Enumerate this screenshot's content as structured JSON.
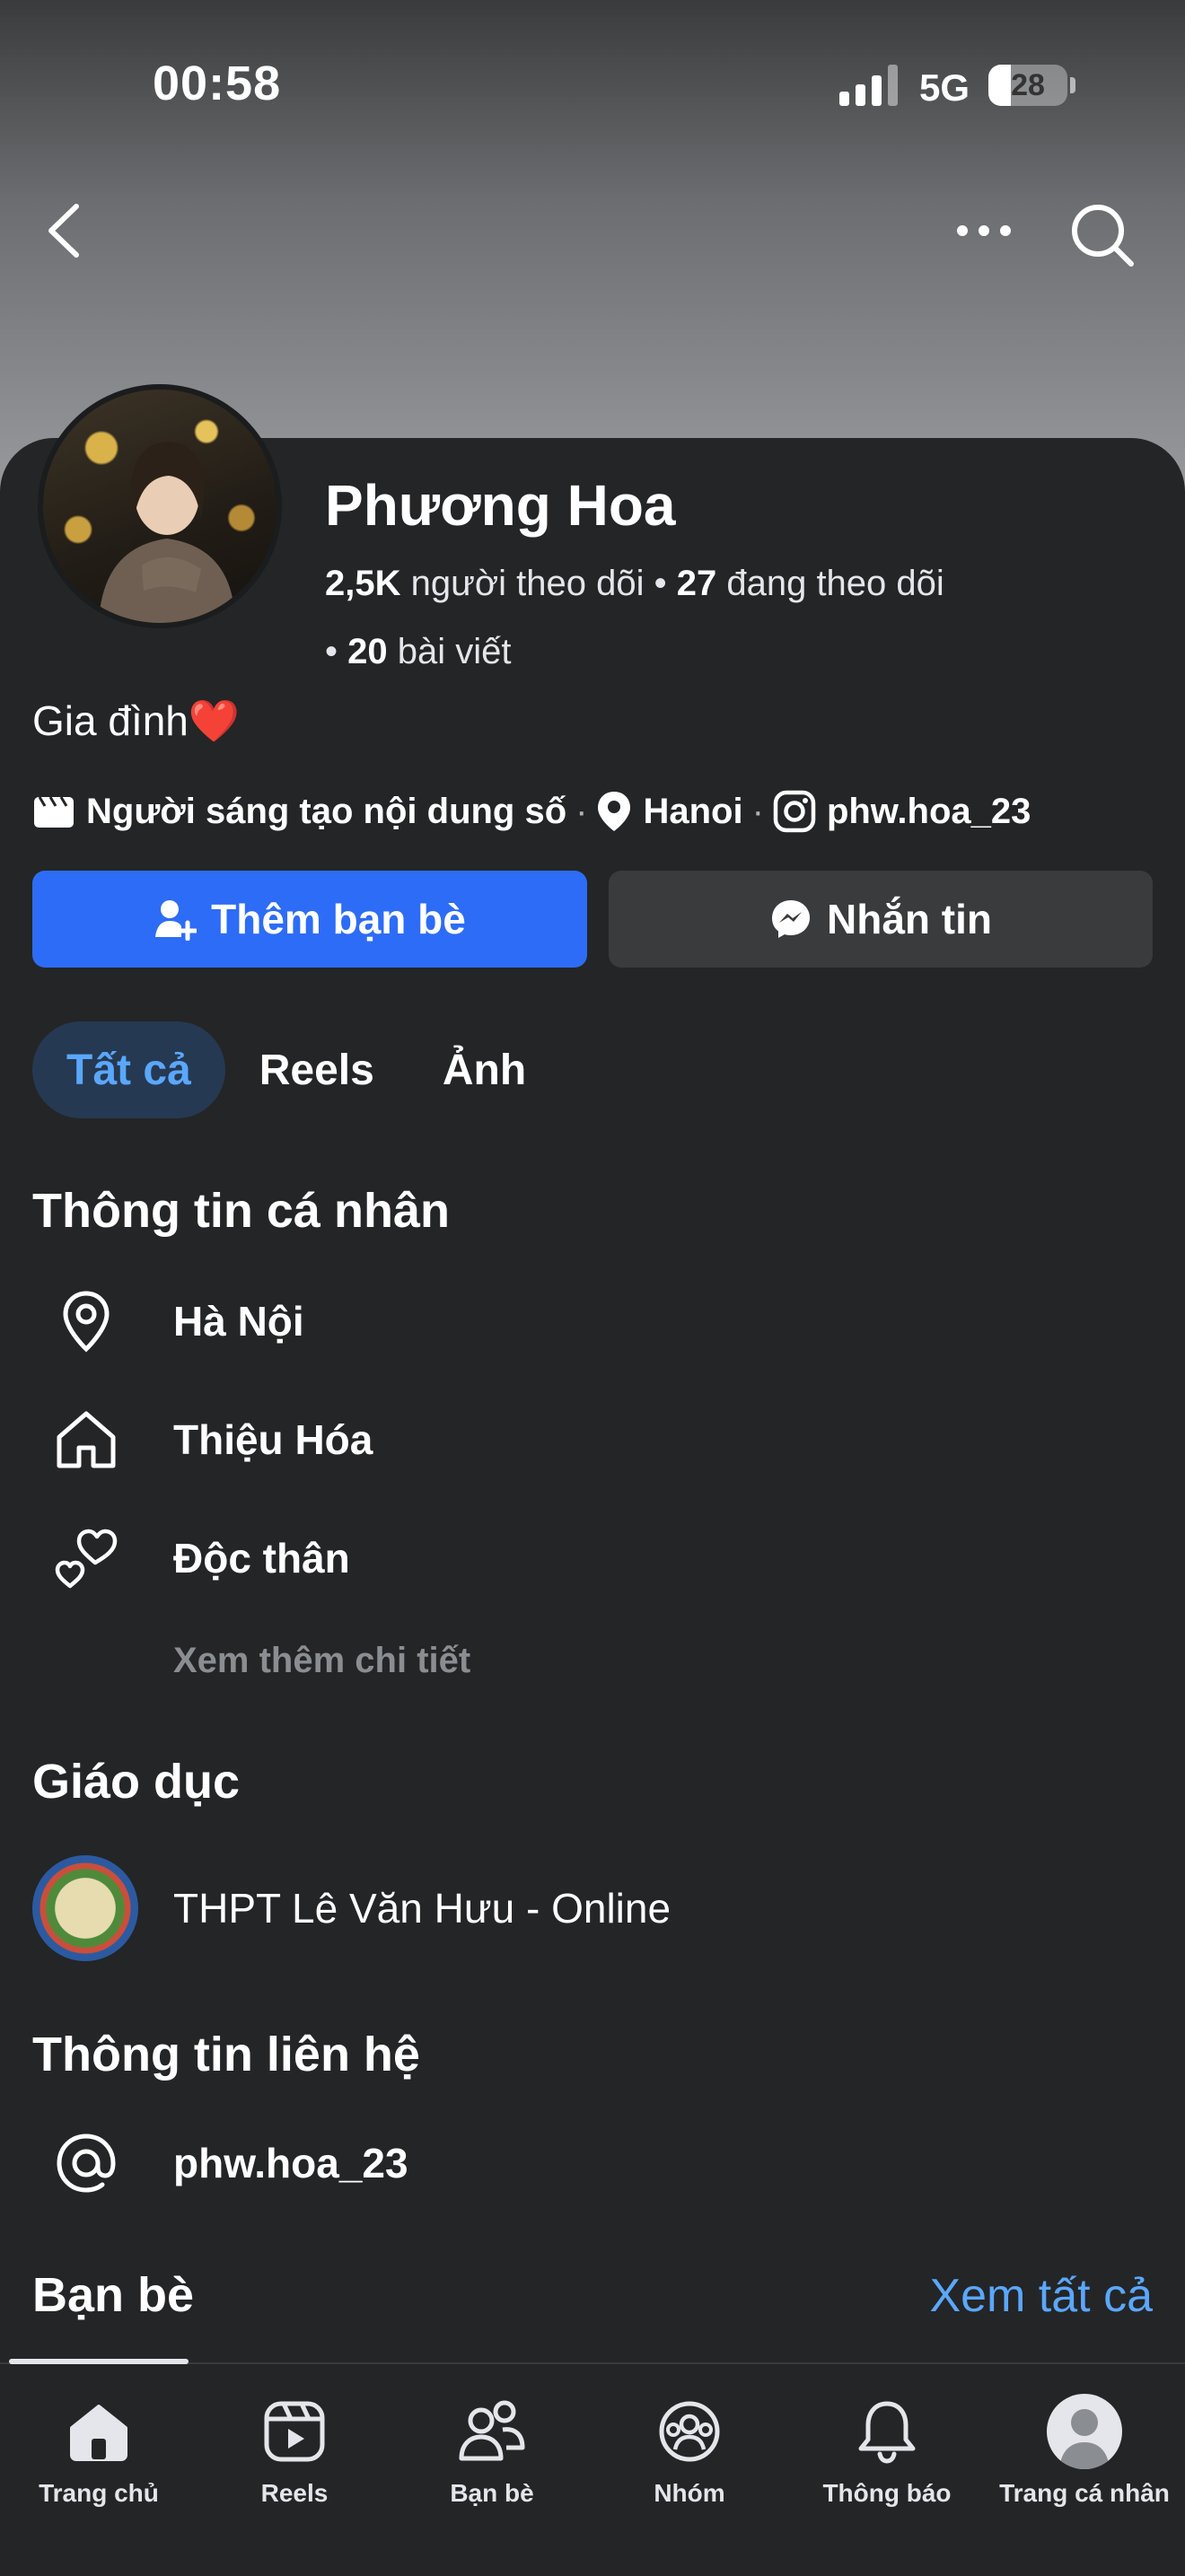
{
  "status_bar": {
    "time": "00:58",
    "network": "5G",
    "battery": "28"
  },
  "profile": {
    "name": "Phương Hoa",
    "followers_count": "2,5K",
    "followers_label": "người theo dõi",
    "following_count": "27",
    "following_label": "đang theo dõi",
    "posts_count": "20",
    "posts_label": "bài viết",
    "bio": "Gia đình",
    "bio_emoji": "❤️",
    "category": "Người sáng tạo nội dung số",
    "location": "Hanoi",
    "instagram": "phw.hoa_23"
  },
  "actions": {
    "add_friend": "Thêm bạn bè",
    "message": "Nhắn tin"
  },
  "tabs": [
    {
      "label": "Tất cả",
      "active": true
    },
    {
      "label": "Reels",
      "active": false
    },
    {
      "label": "Ảnh",
      "active": false
    }
  ],
  "personal_info": {
    "title": "Thông tin cá nhân",
    "items": [
      {
        "icon": "location-pin-icon",
        "text": "Hà Nội"
      },
      {
        "icon": "home-icon",
        "text": "Thiệu Hóa"
      },
      {
        "icon": "hearts-icon",
        "text": "Độc thân"
      }
    ],
    "see_more": "Xem thêm chi tiết"
  },
  "education": {
    "title": "Giáo dục",
    "school": "THPT Lê Văn Hưu - Online"
  },
  "contact": {
    "title": "Thông tin liên hệ",
    "handle": "phw.hoa_23"
  },
  "friends": {
    "title": "Bạn bè",
    "see_all": "Xem tất cả"
  },
  "bottom_nav": [
    {
      "icon": "home-icon",
      "label": "Trang chủ"
    },
    {
      "icon": "reels-icon",
      "label": "Reels"
    },
    {
      "icon": "friends-icon",
      "label": "Bạn bè"
    },
    {
      "icon": "groups-icon",
      "label": "Nhóm"
    },
    {
      "icon": "bell-icon",
      "label": "Thông báo"
    },
    {
      "icon": "profile-avatar-icon",
      "label": "Trang cá nhân"
    }
  ],
  "colors": {
    "accent": "#2d6cf6",
    "link": "#5aa7ff",
    "background": "#242526"
  }
}
